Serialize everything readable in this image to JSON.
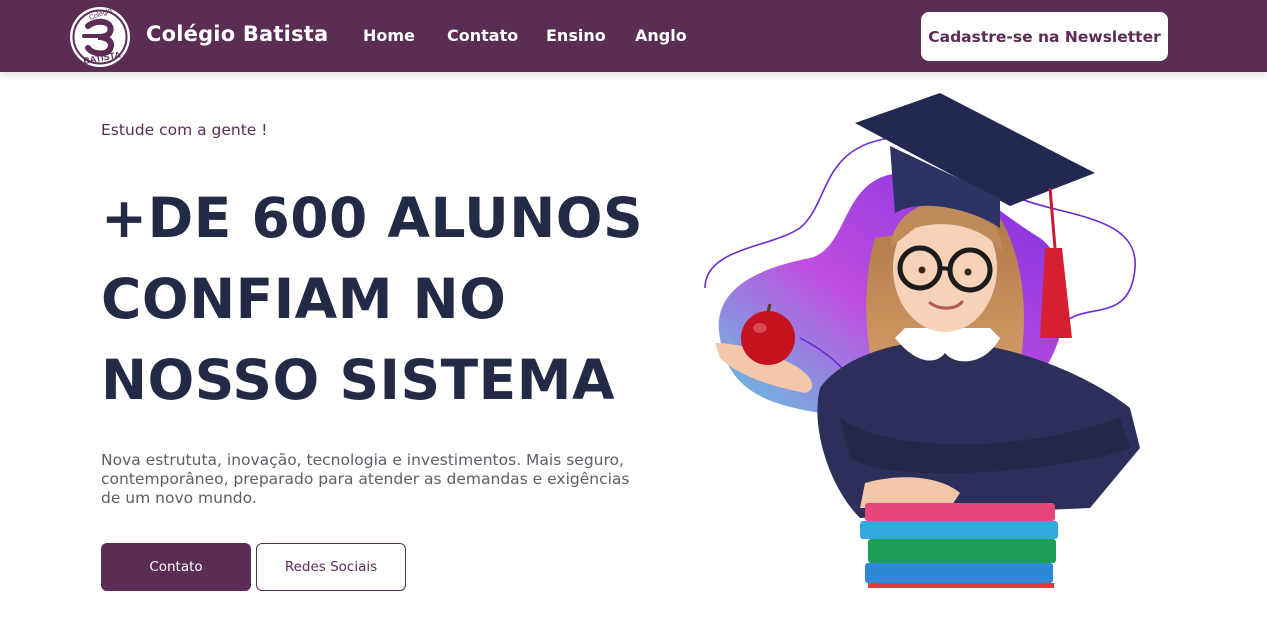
{
  "header": {
    "brand": "Colégio Batista",
    "logo_text_top": "Colégio",
    "logo_text_bottom": "BATISTA",
    "nav": [
      {
        "label": "Home"
      },
      {
        "label": "Contato"
      },
      {
        "label": "Ensino"
      },
      {
        "label": "Anglo"
      }
    ],
    "newsletter_button": "Cadastre-se na Newsletter"
  },
  "hero": {
    "eyebrow": "Estude com a gente !",
    "headline_lines": [
      "+DE 600 ALUNOS",
      "CONFIAM NO",
      "NOSSO SISTEMA"
    ],
    "description": "Nova estrututa, inovação, tecnologia e investimentos. Mais seguro, contemporâneo, preparado para atender as demandas e exigências de um novo mundo.",
    "primary_button": "Contato",
    "secondary_button": "Redes Sociais"
  },
  "colors": {
    "brand_purple": "#5b2d55",
    "headline_navy": "#232a45",
    "body_gray": "#5e5e66"
  }
}
